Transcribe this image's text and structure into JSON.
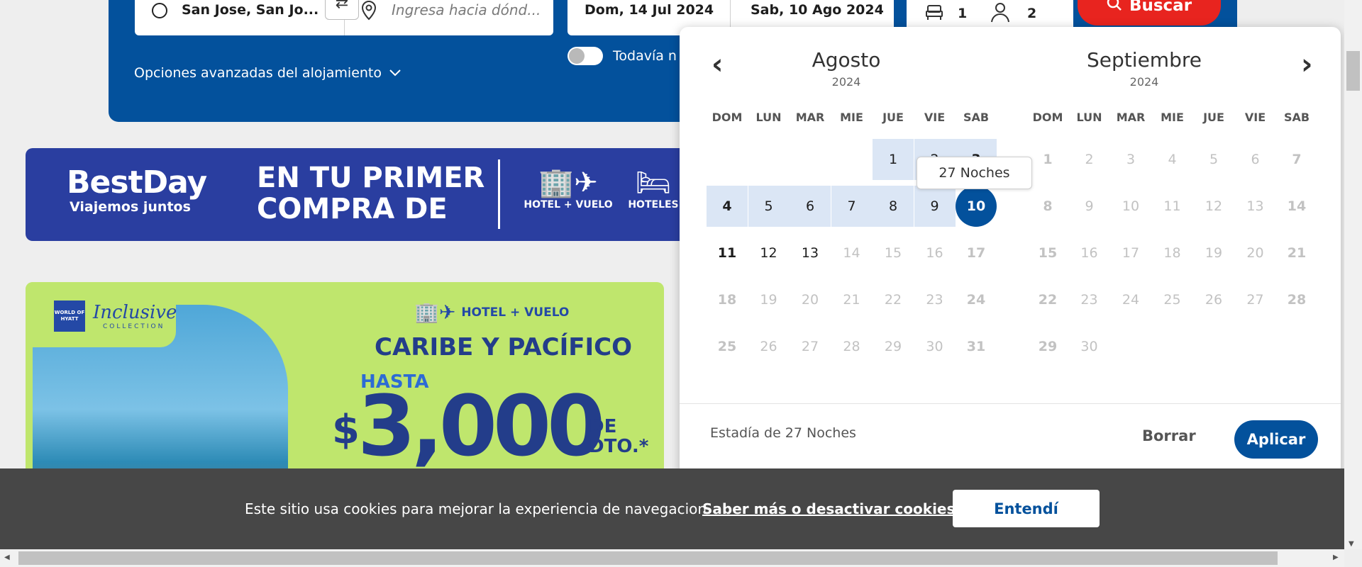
{
  "search": {
    "origin_value": "San Jose, San Jo...",
    "destination_placeholder": "Ingresa hacia dónd...",
    "checkin": "Dom, 14 Jul 2024",
    "checkout": "Sab, 10 Ago 2024",
    "rooms": "1",
    "guests": "2",
    "search_label": "Buscar",
    "advanced_label": "Opciones avanzadas del alojamiento",
    "toggle_label": "Todavía n"
  },
  "banner_bestday": {
    "brand": "BestDay",
    "tagline": "Viajemos juntos",
    "headline_line1": "EN TU PRIMER",
    "headline_line2": "COMPRA DE",
    "cat1": "HOTEL + VUELO",
    "cat2": "HOTELES"
  },
  "banner_hyatt": {
    "logo_text": "WORLD OF HYATT",
    "collection_script": "Inclusive",
    "collection_small": "COLLECTION",
    "product": "HOTEL + VUELO",
    "title": "CARIBE Y PACÍFICO",
    "hasta": "HASTA",
    "currency": "$",
    "amount": "3,000",
    "suffix_line1": "DE",
    "suffix_line2": "DTO.*"
  },
  "calendar": {
    "prev_arrow": "‹",
    "next_arrow": "›",
    "months": [
      {
        "name": "Agosto",
        "year": "2024",
        "weekdays": [
          "DOM",
          "LUN",
          "MAR",
          "MIE",
          "JUE",
          "VIE",
          "SAB"
        ],
        "weeks": [
          [
            "",
            "",
            "",
            "",
            "1",
            "2",
            "3"
          ],
          [
            "4",
            "5",
            "6",
            "7",
            "8",
            "9",
            "10"
          ],
          [
            "11",
            "12",
            "13",
            "14",
            "15",
            "16",
            "17"
          ],
          [
            "18",
            "19",
            "20",
            "21",
            "22",
            "23",
            "24"
          ],
          [
            "25",
            "26",
            "27",
            "28",
            "29",
            "30",
            "31"
          ]
        ]
      },
      {
        "name": "Septiembre",
        "year": "2024",
        "weekdays": [
          "DOM",
          "LUN",
          "MAR",
          "MIE",
          "JUE",
          "VIE",
          "SAB"
        ],
        "weeks": [
          [
            "1",
            "2",
            "3",
            "4",
            "5",
            "6",
            "7"
          ],
          [
            "8",
            "9",
            "10",
            "11",
            "12",
            "13",
            "14"
          ],
          [
            "15",
            "16",
            "17",
            "18",
            "19",
            "20",
            "21"
          ],
          [
            "22",
            "23",
            "24",
            "25",
            "26",
            "27",
            "28"
          ],
          [
            "29",
            "30",
            "",
            "",
            "",
            "",
            ""
          ]
        ]
      }
    ],
    "tooltip": "27 Noches",
    "stay_text": "Estadía de 27 Noches",
    "clear_label": "Borrar",
    "apply_label": "Aplicar"
  },
  "cookies": {
    "text": "Este sitio usa cookies para mejorar la experiencia de navegacion.",
    "link": "Saber más o desactivar cookies.",
    "button": "Entendí"
  }
}
